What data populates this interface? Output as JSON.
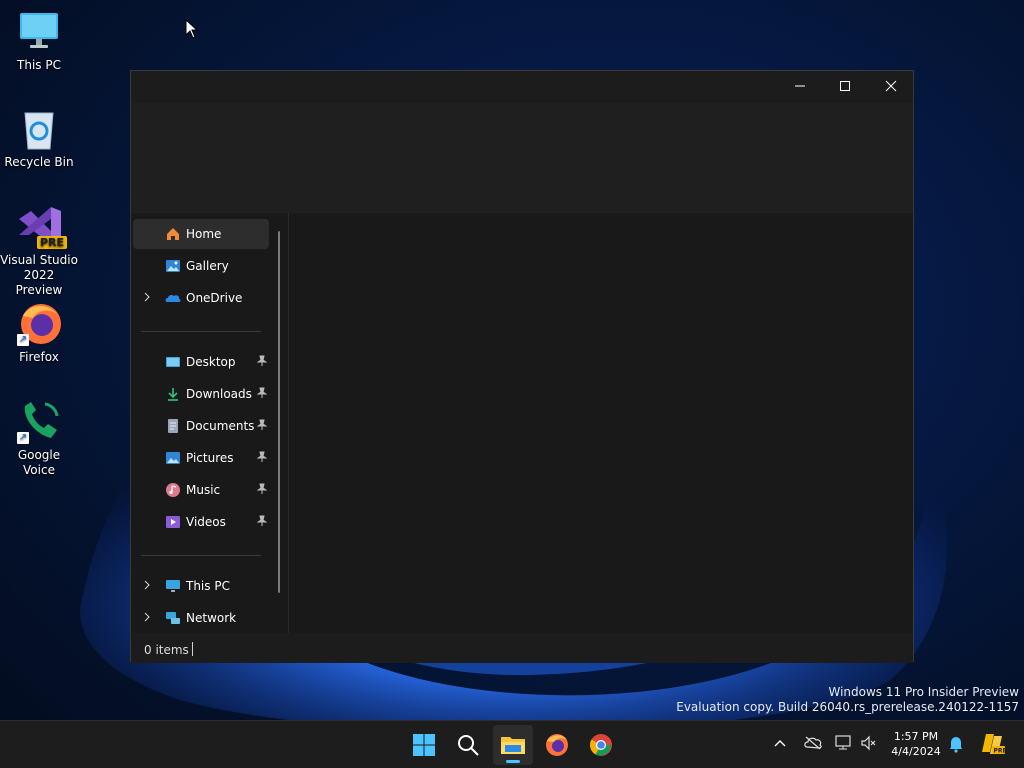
{
  "desktop": {
    "icons": [
      {
        "label_line1": "This PC",
        "label_line2": ""
      },
      {
        "label_line1": "Recycle Bin",
        "label_line2": ""
      },
      {
        "label_line1": "Visual Studio",
        "label_line2": "2022 Preview",
        "badge": "PRE"
      },
      {
        "label_line1": "Firefox",
        "label_line2": ""
      },
      {
        "label_line1": "Google Voice",
        "label_line2": ""
      }
    ],
    "watermark_line1": "Windows 11 Pro Insider Preview",
    "watermark_line2": "Evaluation copy. Build 26040.rs_prerelease.240122-1157"
  },
  "explorer": {
    "nav": {
      "items": [
        {
          "label": "Home",
          "icon": "home-icon",
          "selected": true
        },
        {
          "label": "Gallery",
          "icon": "gallery-icon"
        },
        {
          "label": "OneDrive",
          "icon": "onedrive-icon",
          "expandable": true
        },
        {
          "label": "Desktop",
          "icon": "desktop-folder-icon",
          "pinned": true
        },
        {
          "label": "Downloads",
          "icon": "downloads-icon",
          "pinned": true
        },
        {
          "label": "Documents",
          "icon": "documents-icon",
          "pinned": true
        },
        {
          "label": "Pictures",
          "icon": "pictures-icon",
          "pinned": true
        },
        {
          "label": "Music",
          "icon": "music-icon",
          "pinned": true
        },
        {
          "label": "Videos",
          "icon": "videos-icon",
          "pinned": true
        },
        {
          "label": "This PC",
          "icon": "this-pc-icon",
          "expandable": true
        },
        {
          "label": "Network",
          "icon": "network-icon",
          "expandable": true
        }
      ]
    },
    "status": {
      "item_count": "0 items"
    }
  },
  "taskbar": {
    "clock_time": "1:57 PM",
    "clock_date": "4/4/2024",
    "accent": "#4cc2ff"
  }
}
